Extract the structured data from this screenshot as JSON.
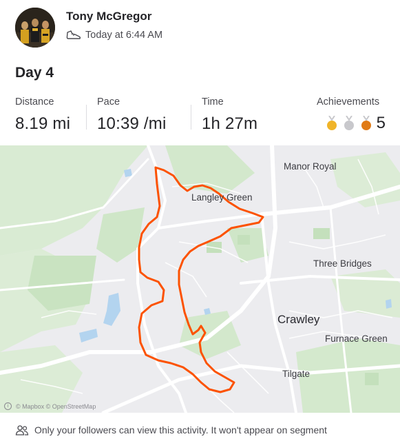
{
  "athlete": {
    "name": "Tony McGregor",
    "avatar_icon": "group-photo-avatar"
  },
  "activity": {
    "sport_icon": "shoe-icon",
    "timestamp": "Today at 6:44 AM",
    "title": "Day 4"
  },
  "stats": [
    {
      "label": "Distance",
      "value": "8.19 mi"
    },
    {
      "label": "Pace",
      "value": "10:39 /mi"
    },
    {
      "label": "Time",
      "value": "1h 27m"
    }
  ],
  "achievements": {
    "label": "Achievements",
    "count": "5",
    "medals": [
      {
        "name": "gold-medal-icon",
        "color": "#f0b429"
      },
      {
        "name": "silver-medal-icon",
        "color": "#c8c8cc"
      },
      {
        "name": "bronze-medal-icon",
        "color": "#e07b16"
      }
    ]
  },
  "map": {
    "route_color": "#fc5200",
    "labels": {
      "manor_royal": "Manor Royal",
      "langley_green": "Langley Green",
      "three_bridges": "Three Bridges",
      "crawley": "Crawley",
      "furnace_green": "Furnace Green",
      "tilgate": "Tilgate"
    },
    "attribution": "© Mapbox © OpenStreetMap"
  },
  "privacy": {
    "icon": "people-icon",
    "text": "Only your followers can view this activity. It won't appear on segment"
  }
}
